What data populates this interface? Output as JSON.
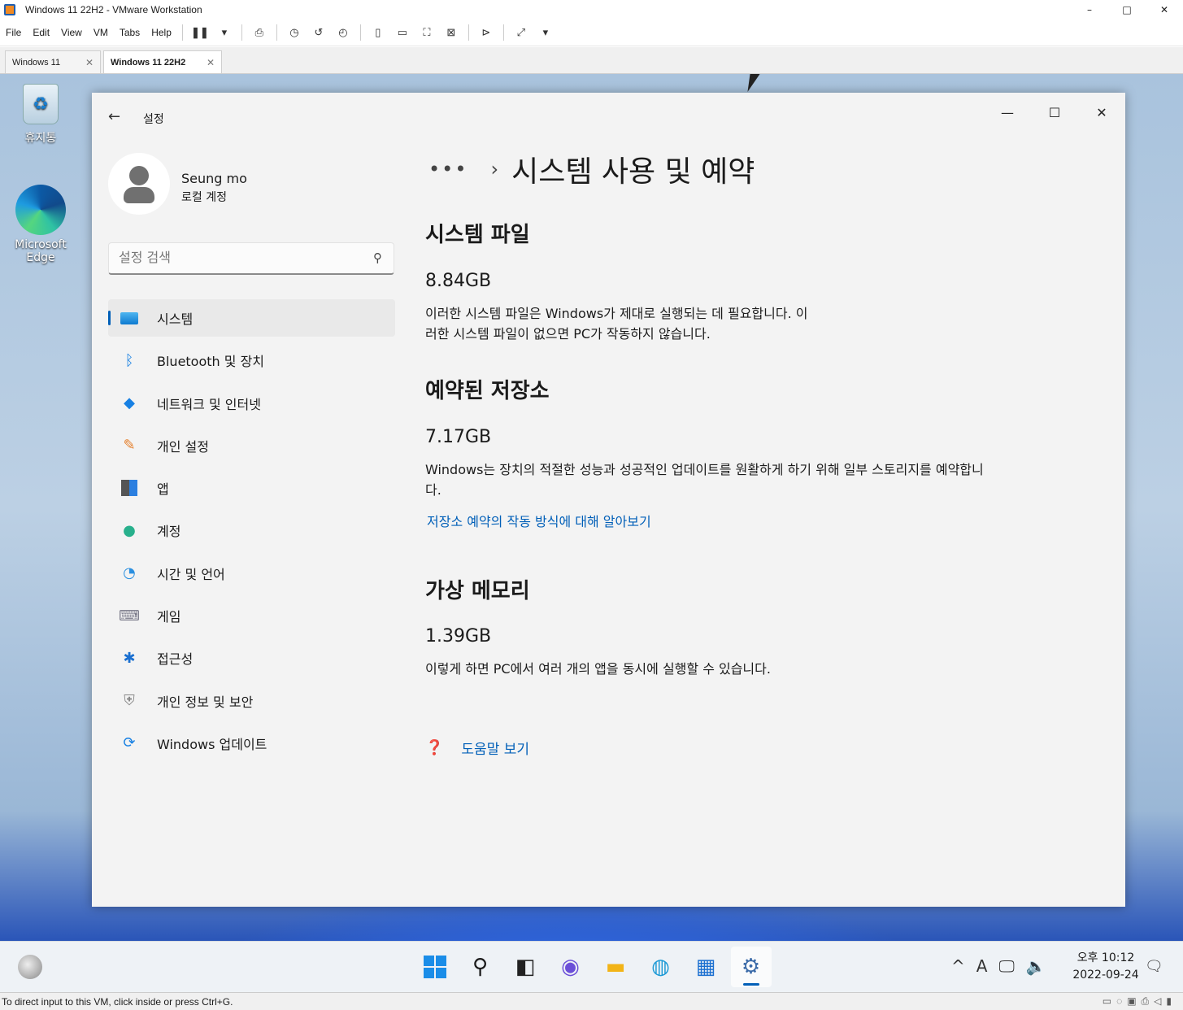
{
  "vmware": {
    "window_title": "Windows 11 22H2 - VMware Workstation",
    "controls": {
      "minimize": "–",
      "maximize": "□",
      "close": "✕"
    },
    "menu": [
      "File",
      "Edit",
      "View",
      "VM",
      "Tabs",
      "Help"
    ],
    "tabs": [
      {
        "label": "Windows 11",
        "close": "✕"
      },
      {
        "label": "Windows 11 22H2",
        "close": "✕"
      }
    ],
    "status_text": "To direct input to this VM, click inside or press Ctrl+G."
  },
  "desktop": {
    "icons": [
      {
        "label": "휴지통",
        "icon": "recycle-bin-icon"
      },
      {
        "label": "Microsoft Edge",
        "icon": "edge-icon"
      }
    ]
  },
  "settings": {
    "app_title": "설정",
    "controls": {
      "minimize": "—",
      "maximize": "☐",
      "close": "✕"
    },
    "user": {
      "name": "Seung mo",
      "account_type": "로컬 계정"
    },
    "search_placeholder": "설정 검색",
    "nav": [
      {
        "label": "시스템",
        "icon": "system-icon",
        "selected": true
      },
      {
        "label": "Bluetooth 및 장치",
        "icon": "bluetooth-icon"
      },
      {
        "label": "네트워크 및 인터넷",
        "icon": "wifi-icon"
      },
      {
        "label": "개인 설정",
        "icon": "brush-icon"
      },
      {
        "label": "앱",
        "icon": "apps-icon"
      },
      {
        "label": "계정",
        "icon": "account-icon"
      },
      {
        "label": "시간 및 언어",
        "icon": "time-language-icon"
      },
      {
        "label": "게임",
        "icon": "gamepad-icon"
      },
      {
        "label": "접근성",
        "icon": "accessibility-icon"
      },
      {
        "label": "개인 정보 및 보안",
        "icon": "shield-icon"
      },
      {
        "label": "Windows 업데이트",
        "icon": "update-icon"
      }
    ],
    "page": {
      "breadcrumb_ellipsis": "•••",
      "title": "시스템 사용 및 예약",
      "sections": [
        {
          "heading": "시스템 파일",
          "size": "8.84GB",
          "description_line1": "이러한 시스템 파일은 Windows가 제대로 실행되는 데 필요합니다. 이",
          "description_line2": "러한 시스템 파일이 없으면 PC가 작동하지 않습니다."
        },
        {
          "heading": "예약된 저장소",
          "size": "7.17GB",
          "description_line1": "Windows는 장치의 적절한 성능과 성공적인 업데이트를 원활하게 하기 위해 일부 스토리지를 예약합니",
          "description_line2": "다.",
          "link": "저장소 예약의 작동 방식에 대해 알아보기"
        },
        {
          "heading": "가상 메모리",
          "size": "1.39GB",
          "description_line1": "이렇게 하면 PC에서 여러 개의 앱을 동시에 실행할 수 있습니다."
        }
      ],
      "help_link": "도움말 보기"
    }
  },
  "taskbar": {
    "pinned": [
      "start-icon",
      "search-icon",
      "task-view-icon",
      "chat-icon",
      "file-explorer-icon",
      "edge-icon",
      "store-icon",
      "settings-icon"
    ],
    "tray": {
      "chevron": "^",
      "ime": "A"
    },
    "clock": {
      "time": "오후 10:12",
      "date": "2022-09-24"
    }
  },
  "colors": {
    "accent": "#005fb8",
    "settings_bg": "#f3f3f3",
    "taskbar_bg": "#eef2f6"
  }
}
